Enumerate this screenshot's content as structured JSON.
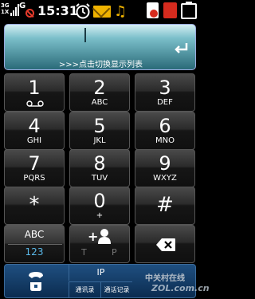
{
  "status_bar": {
    "network_top": "3G",
    "network_bottom": "1X",
    "signal_label": "G",
    "time": "15:31"
  },
  "input": {
    "value": "",
    "hint": ">>>点击切换显示列表"
  },
  "keypad": {
    "keys": [
      {
        "num": "1",
        "sub": ""
      },
      {
        "num": "2",
        "sub": "ABC"
      },
      {
        "num": "3",
        "sub": "DEF"
      },
      {
        "num": "4",
        "sub": "GHI"
      },
      {
        "num": "5",
        "sub": "JKL"
      },
      {
        "num": "6",
        "sub": "MNO"
      },
      {
        "num": "7",
        "sub": "PQRS"
      },
      {
        "num": "8",
        "sub": "TUV"
      },
      {
        "num": "9",
        "sub": "WXYZ"
      },
      {
        "num": "*",
        "sub": ""
      },
      {
        "num": "0",
        "sub": "+"
      },
      {
        "num": "#",
        "sub": ""
      }
    ],
    "mode_top": "ABC",
    "mode_bottom": "123",
    "add_contact_plus": "+",
    "add_contact_t": "T",
    "add_contact_p": "P"
  },
  "bottom_bar": {
    "ip_label": "IP",
    "call_log_label": "通讯录",
    "call_record_label": "通话记录",
    "watermark_cn": "中关村在线",
    "watermark_en": "ZOL.com.cn"
  },
  "colors": {
    "display_gradient_top": "#d4eef2",
    "display_gradient_bottom": "#2a6a78",
    "accent_blue": "#5ab8e8",
    "bottom_bar": "#1f4f80",
    "alert_red": "#d52b1e",
    "mail_yellow": "#f0b300"
  }
}
